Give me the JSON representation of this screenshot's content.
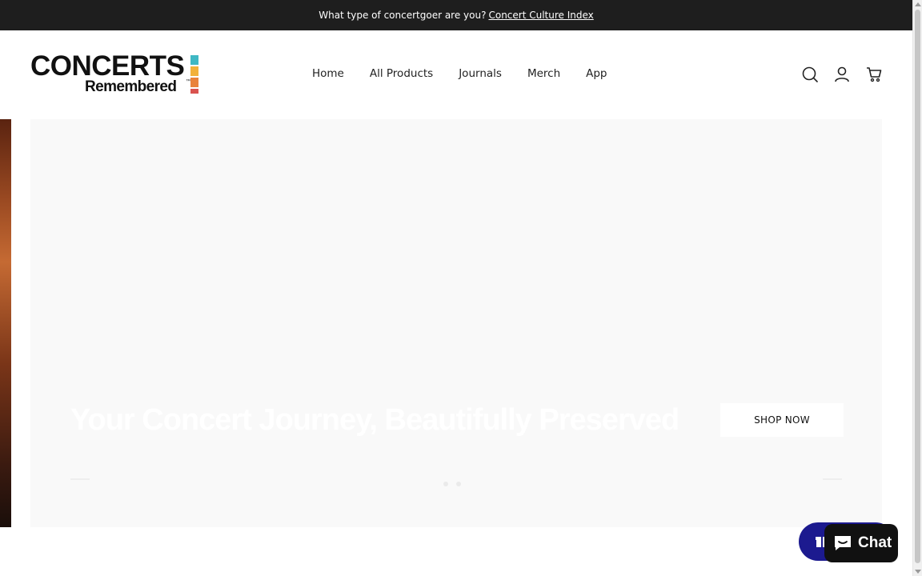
{
  "announcement": {
    "text": "What type of concertgoer are you?",
    "link": "Concert Culture Index"
  },
  "logo": {
    "line1": "CONCERTS",
    "line2": "Remembered",
    "tm": "™",
    "bar_colors": [
      "#3fb8c4",
      "#f2b13a",
      "#e9823a",
      "#d9534f"
    ]
  },
  "nav": {
    "items": [
      "Home",
      "All Products",
      "Journals",
      "Merch",
      "App"
    ]
  },
  "header_icons": [
    "search-icon",
    "account-icon",
    "cart-icon"
  ],
  "hero": {
    "title": "Your Concert Journey, Beautifully Preserved",
    "button": "SHOP NOW",
    "slide_count": 2
  },
  "chat": {
    "label": "Chat"
  },
  "colors": {
    "announcement_bg": "#1e1e1e",
    "rewards_bg": "#1c1a8f",
    "chat_bg": "#111111"
  }
}
